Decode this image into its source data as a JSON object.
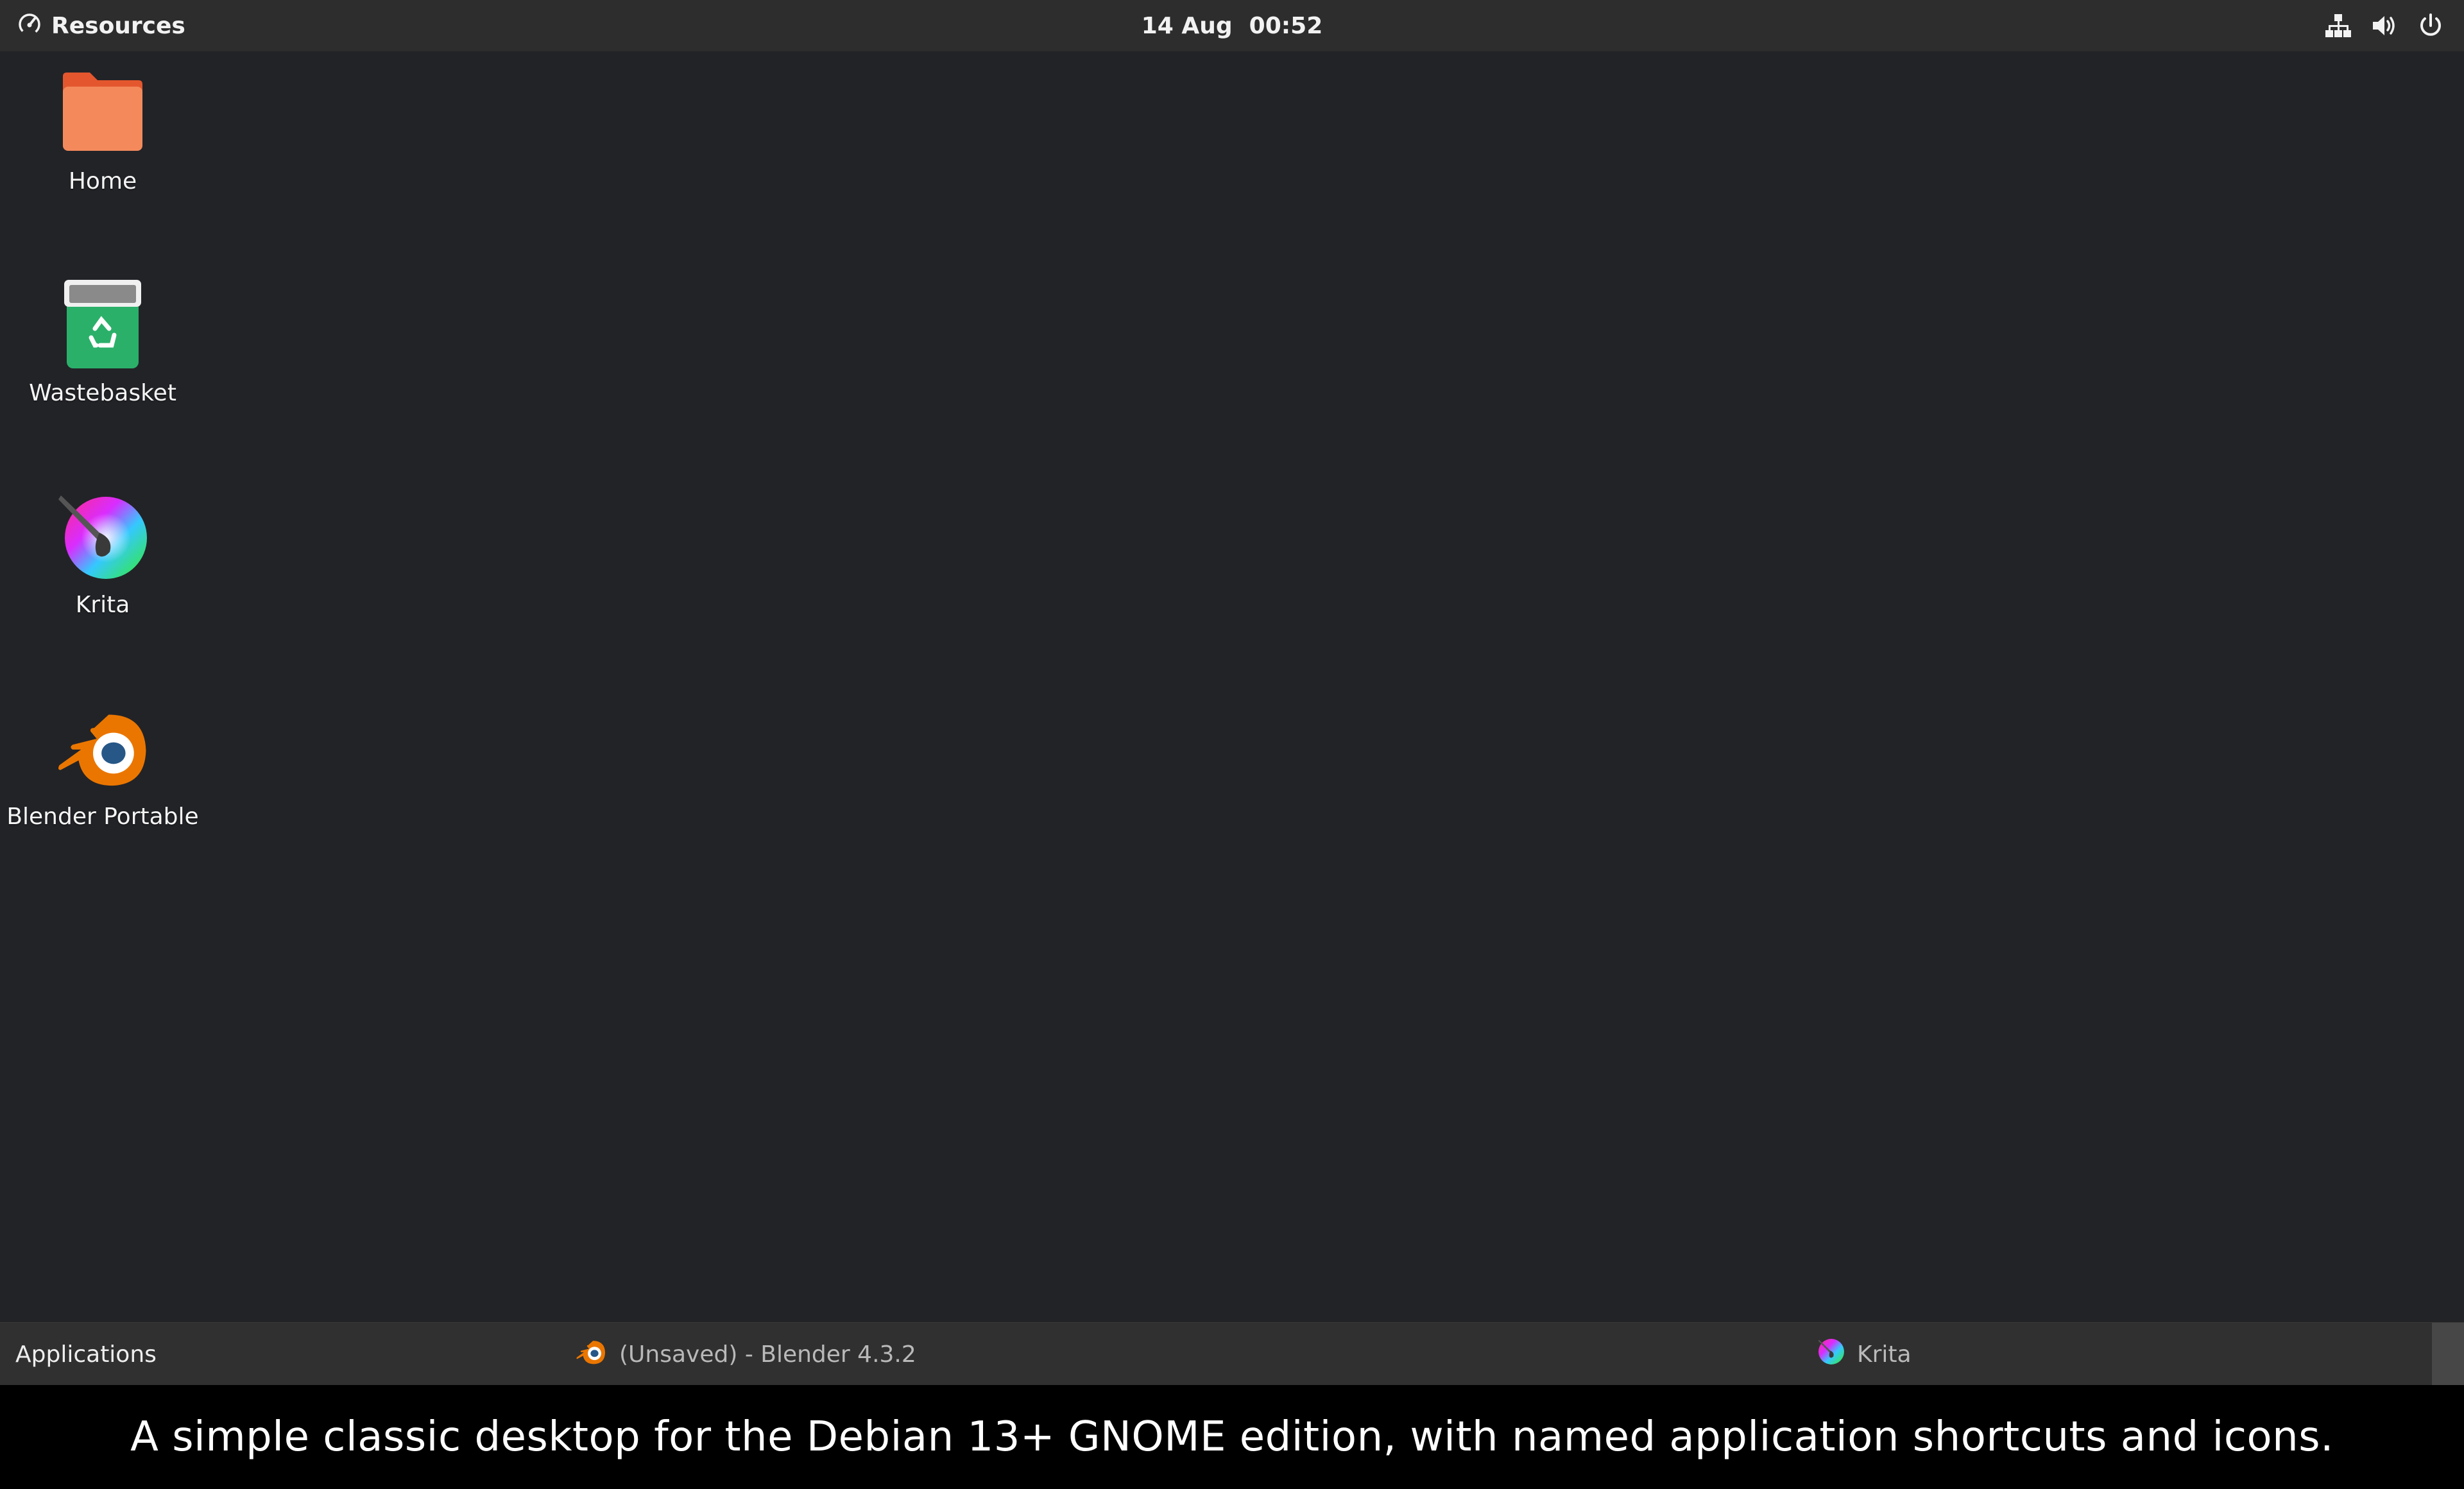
{
  "topbar": {
    "activity_label": "Resources",
    "activity_icon": "speedometer-icon",
    "date": "14 Aug",
    "time": "00:52",
    "tray_icons": [
      "network-wired-icon",
      "volume-icon",
      "power-icon"
    ]
  },
  "desktop": {
    "icons": [
      {
        "label": "Home",
        "icon": "folder-icon"
      },
      {
        "label": "Wastebasket",
        "icon": "trash-icon"
      },
      {
        "label": "Krita",
        "icon": "krita-icon"
      },
      {
        "label": "Blender Portable",
        "icon": "blender-icon"
      }
    ]
  },
  "taskbar": {
    "apps_menu_label": "Applications",
    "tasks": [
      {
        "label": "(Unsaved) - Blender 4.3.2",
        "icon": "blender-icon"
      },
      {
        "label": "Krita",
        "icon": "krita-icon"
      }
    ]
  },
  "caption": {
    "text": "A simple classic desktop for the Debian 13+ GNOME edition, with named application shortcuts and icons."
  },
  "colors": {
    "desktop_bg": "#222327",
    "topbar_bg": "#2d2d2d",
    "taskbar_bg": "#303030",
    "folder_orange": "#f48a5c",
    "trash_green": "#2bb06a",
    "blender_orange": "#ea7600",
    "blender_blue": "#265787"
  }
}
